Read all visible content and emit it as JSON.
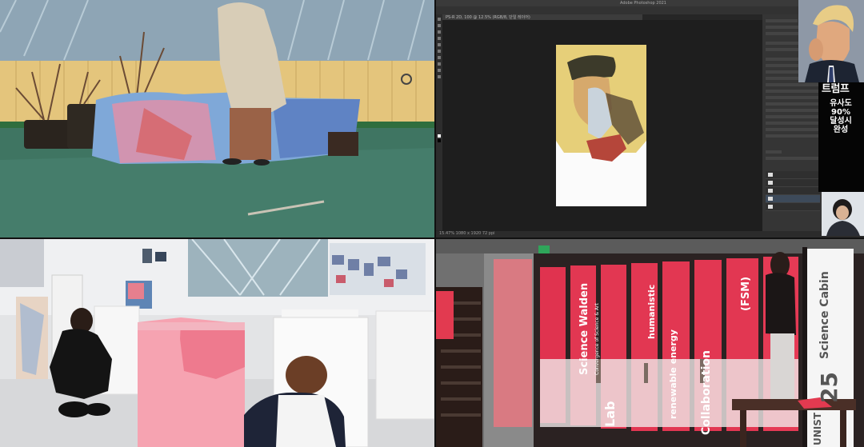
{
  "layout": "2x2 video call grid",
  "photoshop": {
    "window_title": "Adobe Photoshop 2021",
    "document_tab": "PS-R 2D, 100 @ 12.5% (RGB/8, 단일 레이어)",
    "status_bar": "15.47%   1080 x 1920 72 ppi"
  },
  "overlay_caption": {
    "title": "트럼프",
    "body": "유사도90%달성시완성"
  },
  "window_lettering": {
    "pane1_main": "Science Walden",
    "pane1_sub": "Convergence of Science & Art",
    "pane2_main": "humanistic",
    "pane2_sub": "renewable energy",
    "pane3_main": "Collaboration",
    "pane4_main": "(FSM)",
    "pane5_main": "Lab",
    "door_number": "25",
    "door_text": "Science Cabin",
    "door_letters": "UNIST"
  },
  "colors": {
    "window_red": "#e0334f",
    "pink_box": "#f07c8f",
    "floor_green": "#3e6e5a"
  }
}
